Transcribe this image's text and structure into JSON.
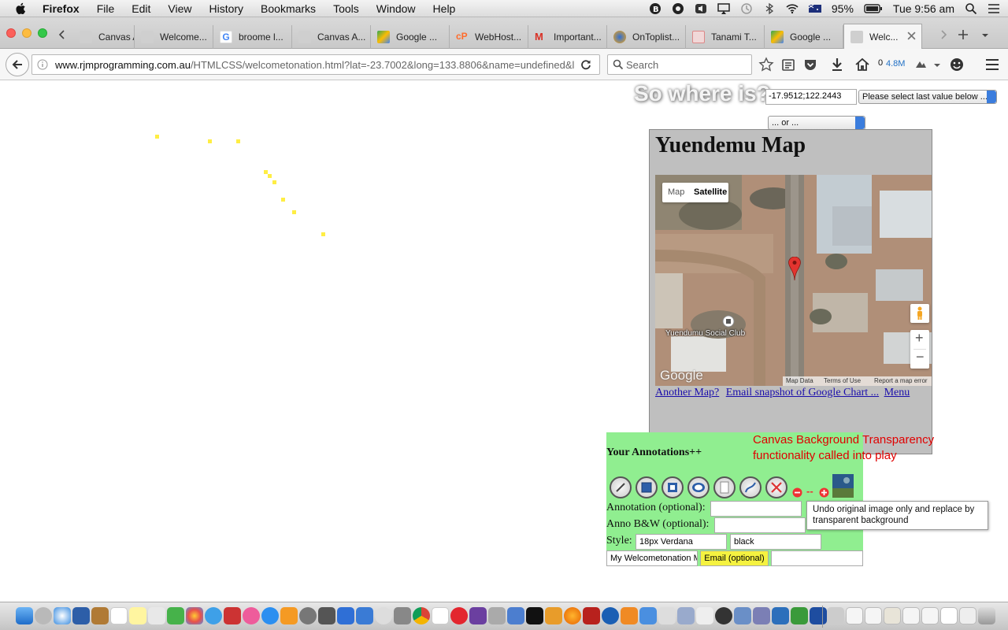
{
  "menubar": {
    "app": "Firefox",
    "items": [
      "File",
      "Edit",
      "View",
      "History",
      "Bookmarks",
      "Tools",
      "Window",
      "Help"
    ],
    "battery": "95%",
    "clock": "Tue 9:56 am",
    "icons": [
      "b-circle-icon",
      "record-icon",
      "speaker-icon",
      "airplay-icon",
      "time-machine-icon",
      "bluetooth-icon",
      "wifi-icon",
      "flag-icon",
      "battery-icon",
      "search-icon",
      "list-icon"
    ]
  },
  "tabs": [
    {
      "label": "Canvas A...",
      "icon": "rjm-favicon"
    },
    {
      "label": "Welcome...",
      "icon": "rjm-favicon"
    },
    {
      "label": "broome l...",
      "icon": "google-favicon"
    },
    {
      "label": "Canvas A...",
      "icon": "rjm-favicon"
    },
    {
      "label": "Google ...",
      "icon": "google-maps-favicon"
    },
    {
      "label": "WebHost...",
      "icon": "cpanel-favicon"
    },
    {
      "label": "Important...",
      "icon": "gmail-favicon"
    },
    {
      "label": "OnToplist...",
      "icon": "ontoplist-favicon"
    },
    {
      "label": "Tanami T...",
      "icon": "tanami-favicon"
    },
    {
      "label": "Google ...",
      "icon": "google-maps-favicon"
    },
    {
      "label": "Welc...",
      "icon": "rjm-favicon",
      "active": true
    }
  ],
  "nav": {
    "url_domain": "www.rjmprogramming.com.au",
    "url_path": "/HTMLCSS/welcometonation.html?lat=-23.7002&long=133.8806&name=undefined&la",
    "search_placeholder": "Search",
    "downloads": "0",
    "size": "4.8M"
  },
  "page": {
    "where_title": "So where is?",
    "coord_value": "-17.9512;122.2443",
    "select_last": "Please select last value below ...",
    "select_or": "... or ...",
    "map_title": "Yuendemu Map",
    "map_tabs": [
      "Map",
      "Satellite"
    ],
    "map_place_label": "Yuendumu Social Club",
    "map_footer": [
      "Map Data",
      "Terms of Use",
      "Report a map error"
    ],
    "google_logo": "Google",
    "links": [
      "Another Map?",
      "Email snapshot of Google Chart ...",
      "Menu"
    ],
    "anno_title": "Your Annotations++",
    "transparency_msg": "Canvas Background Transparency functionality called into play",
    "tooltip": "Undo original image only and replace by transparent background",
    "annotation_label": "Annotation (optional):",
    "anno_bw_label": "Anno B&W (optional):",
    "style_label": "Style:",
    "style_font": "18px Verdana",
    "style_color": "black",
    "subject_value": "My Welcometonation Ma",
    "email_button": "Email (optional)",
    "zoom_minus": "−",
    "zoom_dash": "--",
    "zoom_plus": "+",
    "map_zoom_in": "+",
    "map_zoom_out": "−"
  }
}
